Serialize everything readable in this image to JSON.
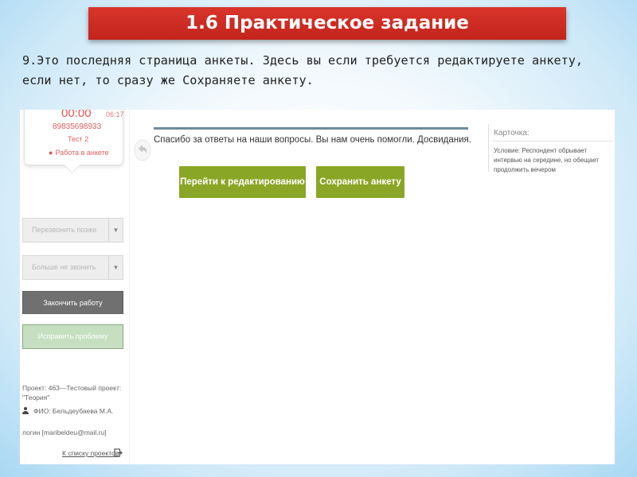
{
  "slide": {
    "title": "1.6 Практическое задание",
    "instruction": "9.Это последняя страница анкеты. Здесь вы если требуется редактируете анкету, если нет, то сразу же Сохраняете анкету."
  },
  "left_panel": {
    "timer": "00:00",
    "timer_small": "06:17",
    "phone": "89835698933",
    "test_label": "Тест 2",
    "status": "Работа в анкете",
    "dropdown_callback": "Перезвонить позже",
    "dropdown_no_call": "Больше не звонить",
    "finish_button": "Закончить работу",
    "fix_button": "Исправить проблему",
    "project": "Проект: 463—Тестовый проект: \"Теория\"",
    "fio": "ФИО: Бельдеубаева М.А.",
    "login": "логин [maribeldeu@mail.ru]",
    "projects_link": "К списку проектов"
  },
  "main": {
    "thanks_message": "Спасибо за ответы на наши вопросы. Вы нам очень помогли. Досвидания.",
    "edit_button": "Перейти к редактированию",
    "save_button": "Сохранить анкету"
  },
  "card": {
    "title": "Карточка:",
    "condition": "Условие: Респондент обрывает интервью на середине, но обещает продолжить вечером"
  },
  "colors": {
    "title_bg": "#c9281f",
    "accent_green": "#8aa626",
    "timer_red": "#e05555"
  }
}
